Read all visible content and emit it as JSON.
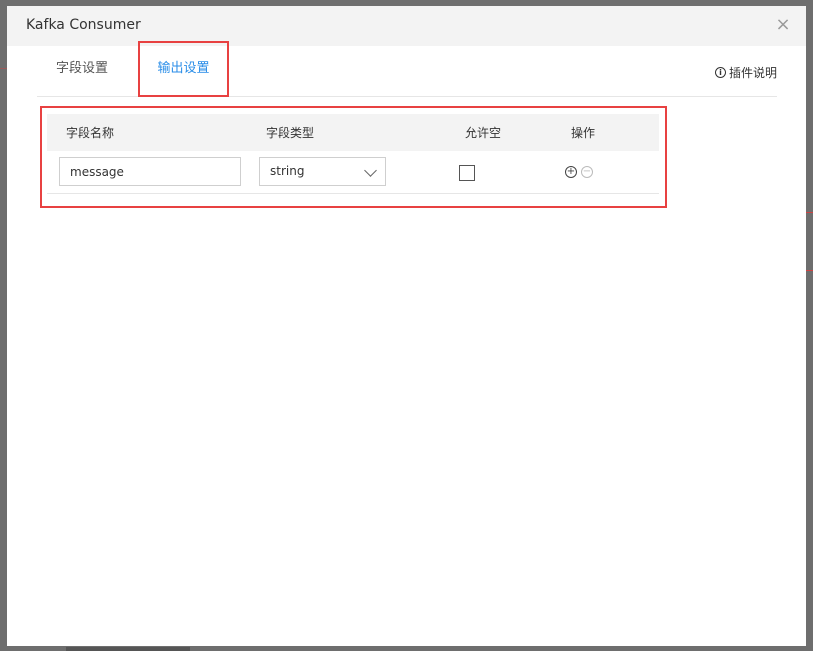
{
  "dialog": {
    "title": "Kafka Consumer",
    "close_glyph": "×"
  },
  "tabs": [
    {
      "label": "字段设置",
      "active": false
    },
    {
      "label": "输出设置",
      "active": true
    }
  ],
  "help": {
    "icon": "info-icon",
    "icon_glyph": "i",
    "label": "插件说明"
  },
  "table": {
    "headers": {
      "name": "字段名称",
      "type": "字段类型",
      "nullable": "允许空",
      "ops": "操作"
    },
    "rows": [
      {
        "name": "message",
        "type": "string",
        "nullable": false
      }
    ],
    "op_plus": "+",
    "op_minus": "−"
  },
  "colors": {
    "accent": "#2b8ee8",
    "highlight": "#e84141",
    "header_bg": "#f3f3f3"
  }
}
